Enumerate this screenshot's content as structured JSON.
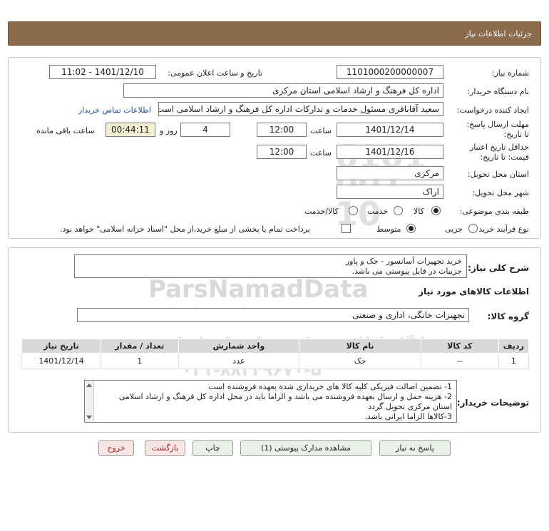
{
  "header": {
    "title": "جزئیات اطلاعات نیاز"
  },
  "info": {
    "need_number_label": "شماره نیاز:",
    "need_number": "1101000200000007",
    "announce_label": "تاریخ و ساعت اعلان عمومی:",
    "announce_value": "1401/12/10 - 11:02",
    "buyer_org_label": "نام دستگاه خریدار:",
    "buyer_org": "اداره کل فرهنگ و ارشاد اسلامی استان مرکزی",
    "requester_label": "ایجاد کننده درخواست:",
    "requester": "سعید آقاباقری مسئول خدمات و تدارکات اداره کل فرهنگ و ارشاد اسلامی است",
    "contact_link": "اطلاعات تماس خریدار",
    "deadline_label": "مهلت ارسال پاسخ: تا تاریخ:",
    "deadline_date": "1401/12/14",
    "time_label": "ساعت",
    "deadline_time": "12:00",
    "days_value": "4",
    "days_label": "روز و",
    "remaining_value": "00:44:11",
    "remaining_label": "ساعت باقی مانده",
    "validity_label": "حداقل تاریخ اعتبار قیمت: تا تاریخ:",
    "validity_date": "1401/12/16",
    "validity_time": "12:00",
    "province_label": "استان محل تحویل:",
    "province": "مرکزی",
    "city_label": "شهر محل تحویل:",
    "city": "اراک",
    "category_label": "طبقه بندی موضوعی:",
    "category_options": [
      "کالا",
      "خدمت",
      "کالا/خدمت"
    ],
    "process_label": "نوع فرآیند خرید :",
    "process_options": [
      "جزیی",
      "متوسط"
    ],
    "payment_note": "پرداخت تمام یا بخشی از مبلغ خرید،از محل \"اسناد خزانه اسلامی\" خواهد بود."
  },
  "summary": {
    "label": "شرح کلی نیاز:",
    "line1": "خرید تجهیزات آسانسور - جک و پاور",
    "line2": "جزییات در فایل پیوستی می باشد."
  },
  "goods": {
    "section_title": "اطلاعات کالاهای مورد نیاز",
    "group_label": "گروه کالا:",
    "group_value": "تجهیزات خانگی، اداری و صنعتی",
    "columns": [
      "ردیف",
      "کد کالا",
      "نام کالا",
      "واحد شمارش",
      "تعداد / مقدار",
      "تاریخ نیاز"
    ],
    "rows": [
      [
        "1",
        "--",
        "جک",
        "عدد",
        "1",
        "1401/12/14"
      ]
    ]
  },
  "buyer_notes": {
    "label": "توضیحات خریدار:",
    "lines": [
      "1- تضمین اصالت فیزیکی کلیه کالا های خریداری شده بعهده فروشنده است",
      "2- هزینه حمل و ارسال بعهده فروشنده می باشد و الزاما باید در محل اداره کل فرهنگ و ارشاد اسلامی استان مرکزی تحویل گردد",
      "3-کالاها الزاما ایرانی باشد."
    ]
  },
  "buttons": {
    "reply": "پاسخ به نیاز",
    "attachments": "مشاهده مدارک پیوستی (1)",
    "print": "چاپ",
    "back": "بازگشت",
    "exit": "خروج"
  },
  "watermark": {
    "brand": "ParsNamadData",
    "fa_line1": "پایگاه اطلاع رسانی مناقصات ایران",
    "fa_line2": "پارس نماد داده",
    "phone": "۰۲۱-۸۸۳۴۹۶۷۰-۵"
  }
}
